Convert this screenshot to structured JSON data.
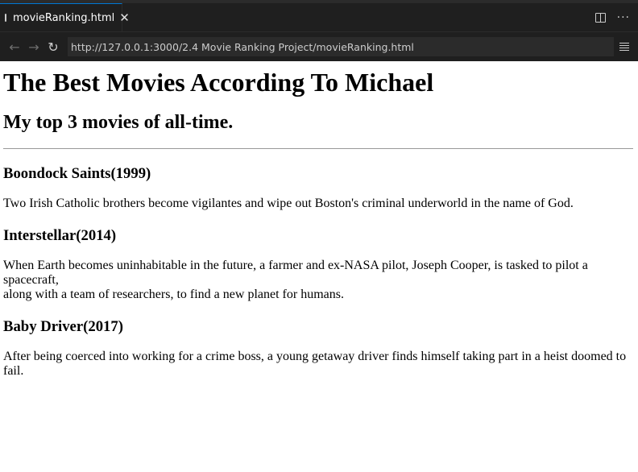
{
  "tab": {
    "title": "movieRanking.html",
    "close": "✕"
  },
  "toolbar": {
    "more": "···"
  },
  "nav": {
    "back": "←",
    "forward": "→",
    "reload": "↻",
    "url": "http://127.0.0.1:3000/2.4 Movie Ranking Project/movieRanking.html"
  },
  "page": {
    "heading": "The Best Movies According To Michael",
    "subheading": "My top 3 movies of all-time.",
    "movies": [
      {
        "title": "Boondock Saints(1999)",
        "lines": [
          "Two Irish Catholic brothers become vigilantes and wipe out Boston's criminal underworld in the name of God."
        ]
      },
      {
        "title": "Interstellar(2014)",
        "lines": [
          "When Earth becomes uninhabitable in the future, a farmer and ex-NASA pilot, Joseph Cooper, is tasked to pilot a spacecraft,",
          "along with a team of researchers, to find a new planet for humans."
        ]
      },
      {
        "title": "Baby Driver(2017)",
        "lines": [
          "After being coerced into working for a crime boss, a young getaway driver finds himself taking part in a heist doomed to fail."
        ]
      }
    ]
  }
}
